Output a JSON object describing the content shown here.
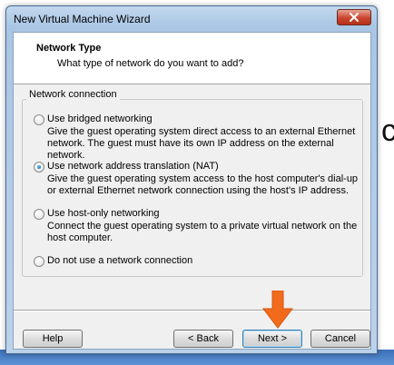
{
  "window": {
    "title": "New Virtual Machine Wizard"
  },
  "header": {
    "title": "Network Type",
    "subtitle": "What type of network do you want to add?"
  },
  "group": {
    "legend": "Network connection",
    "options": [
      {
        "label": "Use bridged networking",
        "checked": false,
        "description": "Give the guest operating system direct access to an external Ethernet network. The guest must have its own IP address on the external network."
      },
      {
        "label": "Use network address translation (NAT)",
        "checked": true,
        "description": "Give the guest operating system access to the host computer's dial-up or external Ethernet network connection using the host's IP address."
      },
      {
        "label": "Use host-only networking",
        "checked": false,
        "description": "Connect the guest operating system to a private virtual network on the host computer."
      },
      {
        "label": "Do not use a network connection",
        "checked": false,
        "description": ""
      }
    ]
  },
  "buttons": {
    "help": "Help",
    "back": "< Back",
    "next": "Next >",
    "cancel": "Cancel"
  },
  "icons": {
    "close": "close-icon",
    "pointer": "arrow-down-icon"
  },
  "colors": {
    "titlebar": "#a9c6e4",
    "close_button": "#c9452f",
    "arrow": "#f26b1d",
    "taskbar": "#3c6fb8"
  }
}
